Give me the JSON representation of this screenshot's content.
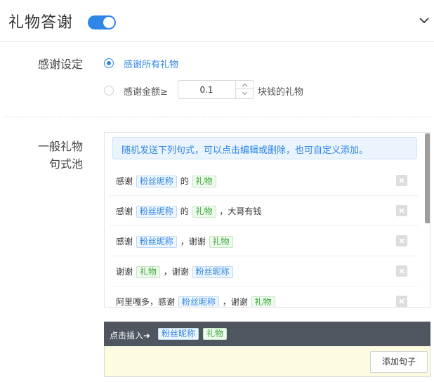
{
  "header": {
    "title": "礼物答谢",
    "toggle_on": true,
    "accent_color": "#2f86e6"
  },
  "thanks_setting": {
    "label": "感谢设定",
    "option_all": "感谢所有礼物",
    "option_amount_prefix": "感谢金额≥",
    "amount_value": "0.1",
    "option_amount_suffix": "块钱的礼物",
    "selected": "option_all"
  },
  "pool": {
    "label_line1": "一般礼物",
    "label_line2": "句式池",
    "notice": "随机发送下列句式，可以点击编辑或删除，也可自定义添加。",
    "rows": [
      {
        "parts": [
          "感谢",
          "粉丝昵称",
          "的",
          "礼物",
          "",
          ""
        ]
      },
      {
        "parts": [
          "感谢",
          "粉丝昵称",
          "的",
          "礼物",
          "，大哥有钱",
          ""
        ]
      },
      {
        "parts": [
          "感谢",
          "粉丝昵称",
          "，谢谢",
          "礼物",
          "",
          ""
        ]
      },
      {
        "parts": [
          "谢谢",
          "礼物",
          "，谢谢",
          "粉丝昵称",
          "",
          ""
        ]
      },
      {
        "parts": [
          "阿里嘎多，感谢",
          "粉丝昵称",
          "，谢谢",
          "礼物",
          "",
          ""
        ]
      }
    ],
    "row_tag_types": [
      [
        "text",
        "fan",
        "text",
        "gift",
        "text"
      ],
      [
        "text",
        "fan",
        "text",
        "gift",
        "text"
      ],
      [
        "text",
        "fan",
        "text",
        "gift"
      ],
      [
        "text",
        "gift",
        "text",
        "fan"
      ],
      [
        "text",
        "fan",
        "text",
        "gift"
      ]
    ]
  },
  "insert": {
    "label": "点击插入➜",
    "fan_tag": "粉丝昵称",
    "gift_tag": "礼物",
    "add_button": "添加句子"
  },
  "icons": {
    "toggle": "toggle-switch",
    "header_chevron": "chevron-down-icon",
    "delete": "close-icon",
    "stepper_up": "chevron-up-icon",
    "stepper_down": "chevron-down-icon"
  }
}
